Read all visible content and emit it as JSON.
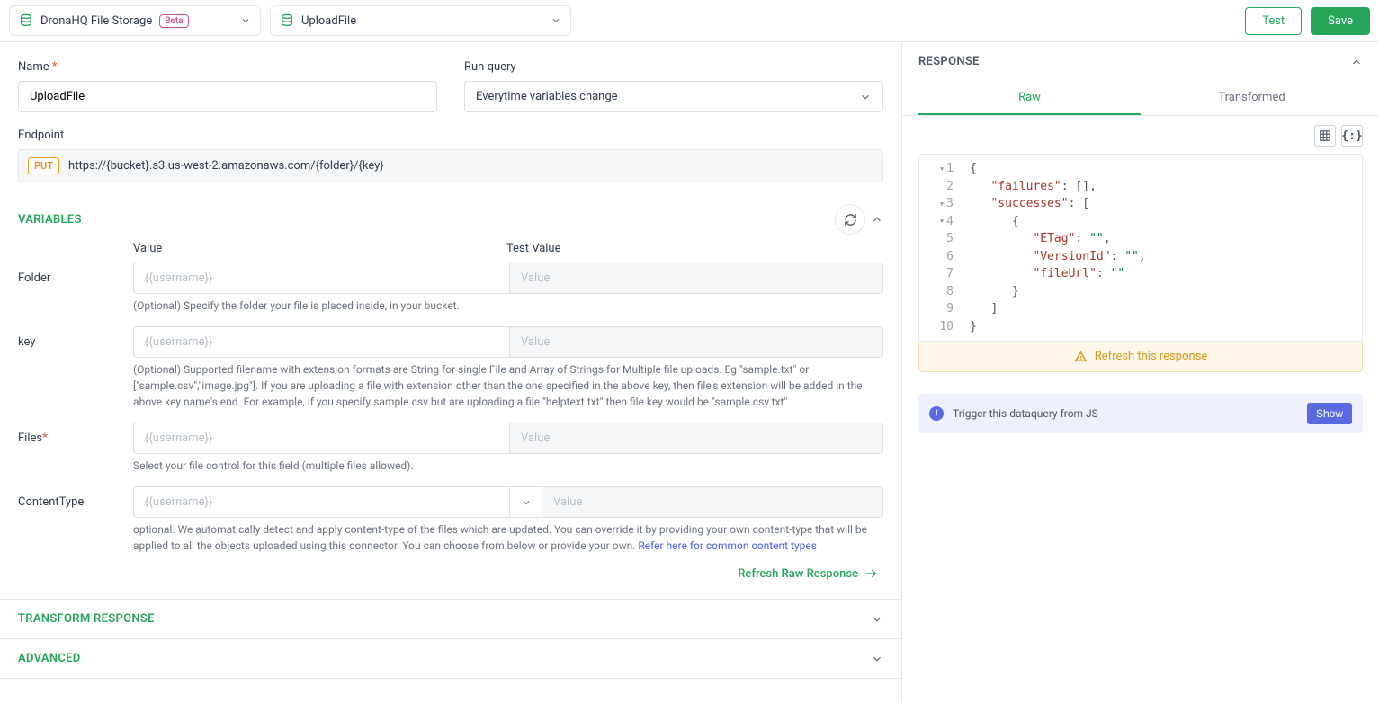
{
  "toolbar": {
    "connector": "DronaHQ File Storage",
    "connectorBadge": "Beta",
    "action": "UploadFile",
    "testLabel": "Test",
    "saveLabel": "Save"
  },
  "form": {
    "nameLabel": "Name",
    "nameValue": "UploadFile",
    "runQueryLabel": "Run query",
    "runQueryValue": "Everytime variables change",
    "endpointLabel": "Endpoint",
    "endpointMethod": "PUT",
    "endpointUrl": "https://{bucket}.s3.us-west-2.amazonaws.com/{folder}/{key}"
  },
  "sections": {
    "variables": "VARIABLES",
    "transform": "TRANSFORM RESPONSE",
    "advanced": "ADVANCED"
  },
  "variables": {
    "colValue": "Value",
    "colTest": "Test Value",
    "placeholderValue": "{{username}}",
    "placeholderTest": "Value",
    "rows": {
      "folder": {
        "label": "Folder",
        "help": "(Optional) Specify the folder your file is placed inside, in your bucket."
      },
      "key": {
        "label": "key",
        "help": "(Optional) Supported filename with extension formats are String for single File and Array of Strings for Multiple file uploads. Eg \"sample.txt\" or [\"sample.csv\",\"image.jpg\"]. If you are uploading a file with extension other than the one specified in the above key, then file's extension will be added in the above key name's end. For example, if you specify sample.csv but are uploading a file \"helptext.txt\" then file key would be \"sample.csv.txt\""
      },
      "files": {
        "label": "Files",
        "required": true,
        "help": "Select your file control for this field (multiple files allowed)."
      },
      "contentType": {
        "label": "ContentType",
        "helpPrefix": "optional. We automatically detect and apply content-type of the files which are updated. You can override it by providing your own content-type that will be applied to all the objects uploaded using this connector. You can choose from below or provide your own. ",
        "helpLink": "Refer here for common content types"
      }
    },
    "refreshRaw": "Refresh Raw Response"
  },
  "response": {
    "title": "RESPONSE",
    "tabRaw": "Raw",
    "tabTransformed": "Transformed",
    "refresh": "Refresh this response",
    "trigger": "Trigger this dataquery from JS",
    "showBtn": "Show",
    "lines": [
      {
        "n": "1",
        "fold": true
      },
      {
        "n": "2"
      },
      {
        "n": "3",
        "fold": true
      },
      {
        "n": "4",
        "fold": true
      },
      {
        "n": "5"
      },
      {
        "n": "6"
      },
      {
        "n": "7"
      },
      {
        "n": "8"
      },
      {
        "n": "9"
      },
      {
        "n": "10"
      }
    ],
    "tokens": [
      [
        {
          "t": "{",
          "c": "pun"
        }
      ],
      [
        {
          "t": "   ",
          "c": "pun"
        },
        {
          "t": "\"failures\"",
          "c": "key"
        },
        {
          "t": ": [],",
          "c": "pun"
        }
      ],
      [
        {
          "t": "   ",
          "c": "pun"
        },
        {
          "t": "\"successes\"",
          "c": "key"
        },
        {
          "t": ": [",
          "c": "pun"
        }
      ],
      [
        {
          "t": "      {",
          "c": "pun"
        }
      ],
      [
        {
          "t": "         ",
          "c": "pun"
        },
        {
          "t": "\"ETag\"",
          "c": "key"
        },
        {
          "t": ": ",
          "c": "pun"
        },
        {
          "t": "\"\"",
          "c": "str"
        },
        {
          "t": ",",
          "c": "pun"
        }
      ],
      [
        {
          "t": "         ",
          "c": "pun"
        },
        {
          "t": "\"VersionId\"",
          "c": "key"
        },
        {
          "t": ": ",
          "c": "pun"
        },
        {
          "t": "\"\"",
          "c": "str"
        },
        {
          "t": ",",
          "c": "pun"
        }
      ],
      [
        {
          "t": "         ",
          "c": "pun"
        },
        {
          "t": "\"fileUrl\"",
          "c": "key"
        },
        {
          "t": ": ",
          "c": "pun"
        },
        {
          "t": "\"\"",
          "c": "str"
        }
      ],
      [
        {
          "t": "      }",
          "c": "pun"
        }
      ],
      [
        {
          "t": "   ]",
          "c": "pun"
        }
      ],
      [
        {
          "t": "}",
          "c": "pun"
        }
      ]
    ]
  }
}
